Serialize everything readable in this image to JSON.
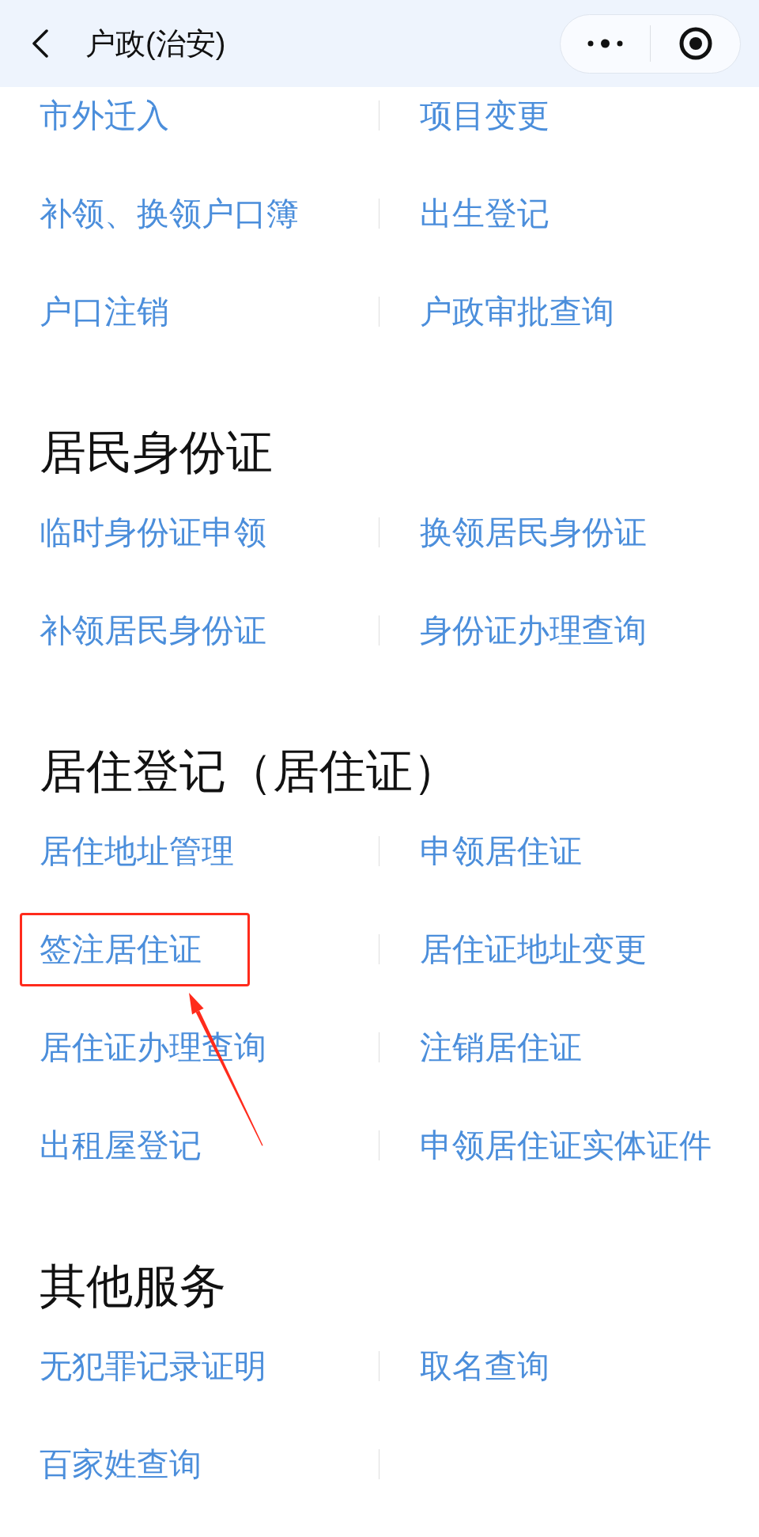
{
  "header": {
    "title": "户政(治安)"
  },
  "sections": [
    {
      "items": [
        {
          "label": "市外迁入",
          "highlighted": false
        },
        {
          "label": "项目变更",
          "highlighted": false
        },
        {
          "label": "补领、换领户口簿",
          "highlighted": false
        },
        {
          "label": "出生登记",
          "highlighted": false
        },
        {
          "label": "户口注销",
          "highlighted": false
        },
        {
          "label": "户政审批查询",
          "highlighted": false
        }
      ]
    },
    {
      "heading": "居民身份证",
      "items": [
        {
          "label": "临时身份证申领",
          "highlighted": false
        },
        {
          "label": "换领居民身份证",
          "highlighted": false
        },
        {
          "label": "补领居民身份证",
          "highlighted": false
        },
        {
          "label": "身份证办理查询",
          "highlighted": false
        }
      ]
    },
    {
      "heading": "居住登记（居住证）",
      "items": [
        {
          "label": "居住地址管理",
          "highlighted": false
        },
        {
          "label": "申领居住证",
          "highlighted": false
        },
        {
          "label": "签注居住证",
          "highlighted": true
        },
        {
          "label": "居住证地址变更",
          "highlighted": false
        },
        {
          "label": "居住证办理查询",
          "highlighted": false
        },
        {
          "label": "注销居住证",
          "highlighted": false
        },
        {
          "label": "出租屋登记",
          "highlighted": false
        },
        {
          "label": "申领居住证实体证件",
          "highlighted": false
        }
      ]
    },
    {
      "heading": "其他服务",
      "items": [
        {
          "label": "无犯罪记录证明",
          "highlighted": false
        },
        {
          "label": "取名查询",
          "highlighted": false
        },
        {
          "label": "百家姓查询",
          "highlighted": false
        }
      ]
    }
  ]
}
